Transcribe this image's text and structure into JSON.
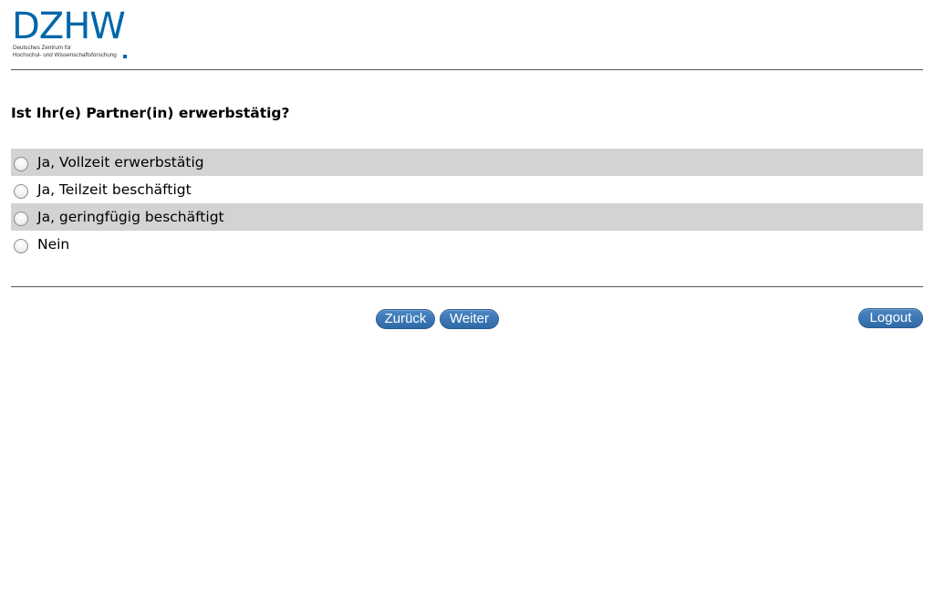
{
  "logo": {
    "mark": "DZHW",
    "subline1": "Deutsches Zentrum für",
    "subline2": "Hochschul- und Wissenschaftsforschung"
  },
  "question": {
    "text": "Ist Ihr(e) Partner(in) erwerbstätig?",
    "options": [
      {
        "label": "Ja, Vollzeit erwerbstätig",
        "selected": false
      },
      {
        "label": "Ja, Teilzeit beschäftigt",
        "selected": false
      },
      {
        "label": "Ja, geringfügig beschäftigt",
        "selected": false
      },
      {
        "label": "Nein",
        "selected": false
      }
    ]
  },
  "nav": {
    "back_label": "Zurück",
    "next_label": "Weiter",
    "logout_label": "Logout"
  },
  "colors": {
    "brand": "#0067a9",
    "button": "#3b76b5",
    "row_shade": "#d3d3d3"
  }
}
